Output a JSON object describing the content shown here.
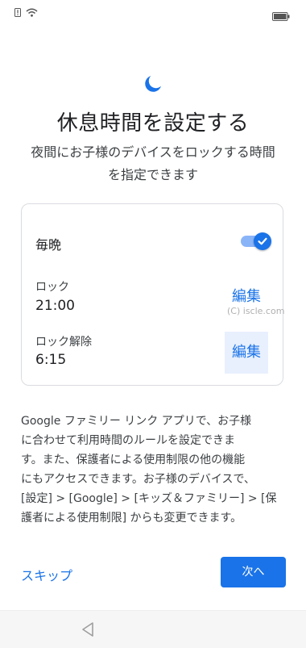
{
  "status_bar": {
    "icons": [
      "alert-icon",
      "wifi-icon",
      "battery-icon"
    ]
  },
  "header": {
    "icon": "moon-icon",
    "title": "休息時間を設定する",
    "subtitle_line1": "夜間にお子様のデバイスをロックする時間",
    "subtitle_line2": "を指定できます"
  },
  "card": {
    "nightly_label": "毎晩",
    "nightly_enabled": true,
    "lock_label": "ロック",
    "lock_time": "21:00",
    "unlock_label": "ロック解除",
    "unlock_time": "6:15",
    "edit_label": "編集"
  },
  "watermark": "(C) iscle.com",
  "body_lines": [
    "Google ファミリー リンク アプリで、お子様",
    "に合わせて利用時間のルールを設定できま",
    "す。また、保護者による使用制限の他の機能",
    "にもアクセスできます。お子様のデバイスで、",
    "[設定] > [Google] > [キッズ＆ファミリー] > [保",
    "護者による使用制限] からも変更できます。"
  ],
  "footer": {
    "skip_label": "スキップ",
    "next_label": "次へ"
  },
  "nav": {
    "icon": "back-icon"
  },
  "colors": {
    "accent": "#1a73e8",
    "toggle_track": "#8ab4f8",
    "edit_focus_bg": "#e8f0fe"
  }
}
